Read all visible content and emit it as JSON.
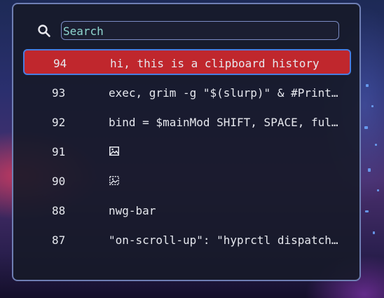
{
  "search": {
    "placeholder": "Search",
    "value": ""
  },
  "clips": [
    {
      "id": "94",
      "text": "hi, this is a clipboard history",
      "selected": true
    },
    {
      "id": "93",
      "text": "exec, grim -g \"$(slurp)\" & #Print…"
    },
    {
      "id": "92",
      "text": "bind = $mainMod SHIFT, SPACE, ful…"
    },
    {
      "id": "91",
      "text": "",
      "icon": "image-icon"
    },
    {
      "id": "90",
      "text": "",
      "icon": "image-select-icon"
    },
    {
      "id": "88",
      "text": "nwg-bar"
    },
    {
      "id": "87",
      "text": "\"on-scroll-up\": \"hyprctl dispatch…"
    }
  ],
  "colors": {
    "selected_bg": "#c0272d",
    "selected_border": "#4a7de0",
    "accent_text": "#8fd7d0",
    "window_border": "#6f7fb3"
  }
}
